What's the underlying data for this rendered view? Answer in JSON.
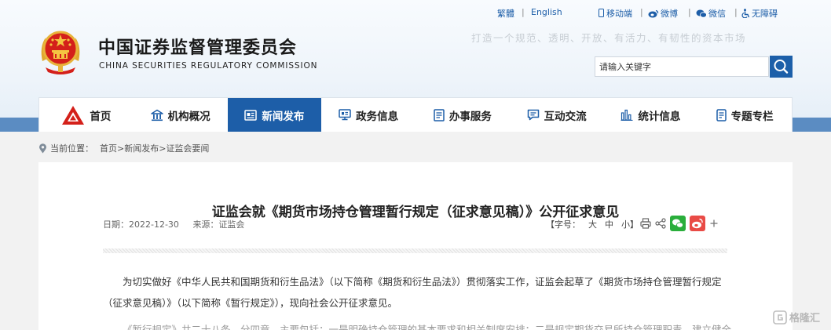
{
  "header": {
    "top_links": [
      {
        "label": "繁體"
      },
      {
        "label": "English"
      },
      {
        "label": "移动端"
      },
      {
        "label": "微博"
      },
      {
        "label": "微信"
      },
      {
        "label": "无障碍"
      }
    ],
    "title_cn": "中国证券监督管理委员会",
    "title_en": "CHINA SECURITIES REGULATORY COMMISSION",
    "slogan": "打造一个规范、透明、开放、有活力、有韧性的资本市场",
    "search": {
      "placeholder": "请输入关键字"
    },
    "colors": {
      "brand_blue": "#1d5ea8",
      "emblem_red": "#d4201a"
    }
  },
  "nav": {
    "items": [
      {
        "label": "首页",
        "icon": "csrc-logo-icon"
      },
      {
        "label": "机构概况",
        "icon": "building-icon"
      },
      {
        "label": "新闻发布",
        "icon": "news-icon",
        "active": true
      },
      {
        "label": "政务信息",
        "icon": "monitor-icon"
      },
      {
        "label": "办事服务",
        "icon": "document-icon"
      },
      {
        "label": "互动交流",
        "icon": "chat-icon"
      },
      {
        "label": "统计信息",
        "icon": "bar-chart-icon"
      },
      {
        "label": "专题专栏",
        "icon": "notebook-icon"
      }
    ]
  },
  "breadcrumb": {
    "prefix": "当前位置：",
    "items": [
      "首页",
      "新闻发布",
      "证监会要闻"
    ],
    "separator": ">"
  },
  "article": {
    "title": "证监会就《期货市场持仓管理暂行规定（征求意见稿）》公开征求意见",
    "date": "日期：2022-12-30",
    "source": "来源：证监会",
    "font_size_label": "【字号：",
    "font_sizes": [
      "大",
      "中",
      "小】"
    ],
    "paragraph1": "为切实做好《中华人民共和国期货和衍生品法》（以下简称《期货和衍生品法》）贯彻落实工作，证监会起草了《期货市场持仓管理暂行规定（征求意见稿）》（以下简称《暂行规定》），现向社会公开征求意见。",
    "paragraph2": "《暂行规定》共二十八条，分四章，主要包括：一是明确持仓管理的基本要求和相关制度安排；二是规定期货交易所持仓管理职责，建立健全持仓管理制度。"
  },
  "share": {
    "icons": [
      "print-icon",
      "share-icon",
      "wechat-icon",
      "weibo-icon",
      "plus-icon"
    ]
  },
  "watermark": {
    "text": "格隆汇"
  }
}
